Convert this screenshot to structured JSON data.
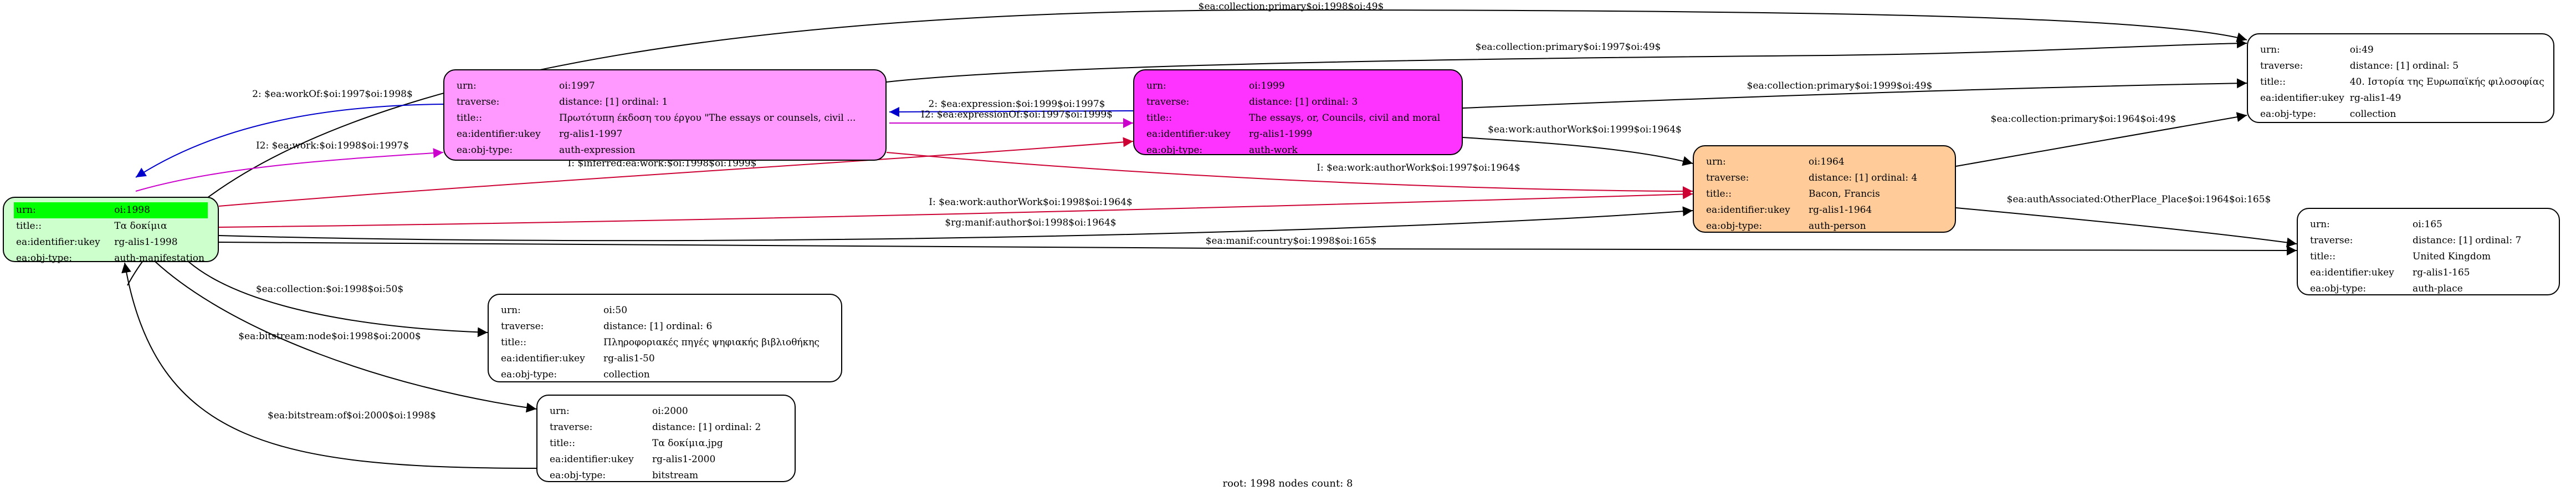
{
  "caption": "root: 1998 nodes count: 8",
  "colors": {
    "root": "#ccffcc",
    "expression": "#ff99ff",
    "work": "#ff33ff",
    "person": "#ffcc99",
    "plain": "#ffffff",
    "highlight": "#00ff00"
  },
  "nodes": {
    "n1998": {
      "rows": [
        {
          "k": "urn:",
          "v": "oi:1998"
        },
        {
          "k": "title::",
          "v": "Τα δοκίμια"
        },
        {
          "k": "ea:identifier:ukey",
          "v": "rg-alis1-1998"
        },
        {
          "k": "ea:obj-type:",
          "v": "auth-manifestation"
        }
      ]
    },
    "n1997": {
      "rows": [
        {
          "k": "urn:",
          "v": "oi:1997"
        },
        {
          "k": "traverse:",
          "v": "distance: [1]     ordinal: 1"
        },
        {
          "k": "title::",
          "v": "Πρωτότυπη έκδοση του έργου \"The essays or counsels, civil ..."
        },
        {
          "k": "ea:identifier:ukey",
          "v": "rg-alis1-1997"
        },
        {
          "k": "ea:obj-type:",
          "v": "auth-expression"
        }
      ]
    },
    "n1999": {
      "rows": [
        {
          "k": "urn:",
          "v": "oi:1999"
        },
        {
          "k": "traverse:",
          "v": "distance: [1]     ordinal: 3"
        },
        {
          "k": "title::",
          "v": "The essays, or, Councils, civil and moral"
        },
        {
          "k": "ea:identifier:ukey",
          "v": "rg-alis1-1999"
        },
        {
          "k": "ea:obj-type:",
          "v": "auth-work"
        }
      ]
    },
    "n1964": {
      "rows": [
        {
          "k": "urn:",
          "v": "oi:1964"
        },
        {
          "k": "traverse:",
          "v": "distance: [1]     ordinal: 4"
        },
        {
          "k": "title::",
          "v": "Bacon, Francis"
        },
        {
          "k": "ea:identifier:ukey",
          "v": "rg-alis1-1964"
        },
        {
          "k": "ea:obj-type:",
          "v": "auth-person"
        }
      ]
    },
    "n49": {
      "rows": [
        {
          "k": "urn:",
          "v": "oi:49"
        },
        {
          "k": "traverse:",
          "v": "distance: [1]     ordinal: 5"
        },
        {
          "k": "title::",
          "v": "40. Ιστορία της Ευρωπαϊκής φιλοσοφίας"
        },
        {
          "k": "ea:identifier:ukey",
          "v": "rg-alis1-49"
        },
        {
          "k": "ea:obj-type:",
          "v": "collection"
        }
      ]
    },
    "n165": {
      "rows": [
        {
          "k": "urn:",
          "v": "oi:165"
        },
        {
          "k": "traverse:",
          "v": "distance: [1]     ordinal: 7"
        },
        {
          "k": "title::",
          "v": "United Kingdom"
        },
        {
          "k": "ea:identifier:ukey",
          "v": "rg-alis1-165"
        },
        {
          "k": "ea:obj-type:",
          "v": "auth-place"
        }
      ]
    },
    "n50": {
      "rows": [
        {
          "k": "urn:",
          "v": "oi:50"
        },
        {
          "k": "traverse:",
          "v": "distance: [1]     ordinal: 6"
        },
        {
          "k": "title::",
          "v": "Πληροφοριακές πηγές ψηφιακής βιβλιοθήκης"
        },
        {
          "k": "ea:identifier:ukey",
          "v": "rg-alis1-50"
        },
        {
          "k": "ea:obj-type:",
          "v": "collection"
        }
      ]
    },
    "n2000": {
      "rows": [
        {
          "k": "urn:",
          "v": "oi:2000"
        },
        {
          "k": "traverse:",
          "v": "distance: [1]     ordinal: 2"
        },
        {
          "k": "title::",
          "v": "Τα δοκίμια.jpg"
        },
        {
          "k": "ea:identifier:ukey",
          "v": "rg-alis1-2000"
        },
        {
          "k": "ea:obj-type:",
          "v": "bitstream"
        }
      ]
    }
  },
  "edges": [
    {
      "label": "$ea:collection:primary$oi:1998$oi:49$",
      "color": "#000000"
    },
    {
      "label": "$ea:collection:primary$oi:1997$oi:49$",
      "color": "#000000"
    },
    {
      "label": "$ea:collection:primary$oi:1999$oi:49$",
      "color": "#000000"
    },
    {
      "label": "$ea:collection:primary$oi:1964$oi:49$",
      "color": "#000000"
    },
    {
      "label": "2: $ea:workOf:$oi:1997$oi:1998$",
      "color": "#0000cc"
    },
    {
      "label": "I2: $ea:work:$oi:1998$oi:1997$",
      "color": "#cc00cc"
    },
    {
      "label": "2: $ea:expression:$oi:1999$oi:1997$",
      "color": "#0000cc"
    },
    {
      "label": "I2: $ea:expressionOf:$oi:1997$oi:1999$",
      "color": "#cc00cc"
    },
    {
      "label": "I: $inferred:ea:work:$oi:1998$oi:1999$",
      "color": "#cc0033"
    },
    {
      "label": "I: $ea:work:authorWork$oi:1997$oi:1964$",
      "color": "#cc0033"
    },
    {
      "label": "$ea:work:authorWork$oi:1999$oi:1964$",
      "color": "#000000"
    },
    {
      "label": "I: $ea:work:authorWork$oi:1998$oi:1964$",
      "color": "#cc0033"
    },
    {
      "label": "$rg:manif:author$oi:1998$oi:1964$",
      "color": "#000000"
    },
    {
      "label": "$ea:authAssociated:OtherPlace_Place$oi:1964$oi:165$",
      "color": "#000000"
    },
    {
      "label": "$ea:manif:country$oi:1998$oi:165$",
      "color": "#000000"
    },
    {
      "label": "$ea:collection:$oi:1998$oi:50$",
      "color": "#000000"
    },
    {
      "label": "$ea:bitstream:node$oi:1998$oi:2000$",
      "color": "#000000"
    },
    {
      "label": "$ea:bitstream:of$oi:2000$oi:1998$",
      "color": "#000000"
    }
  ]
}
